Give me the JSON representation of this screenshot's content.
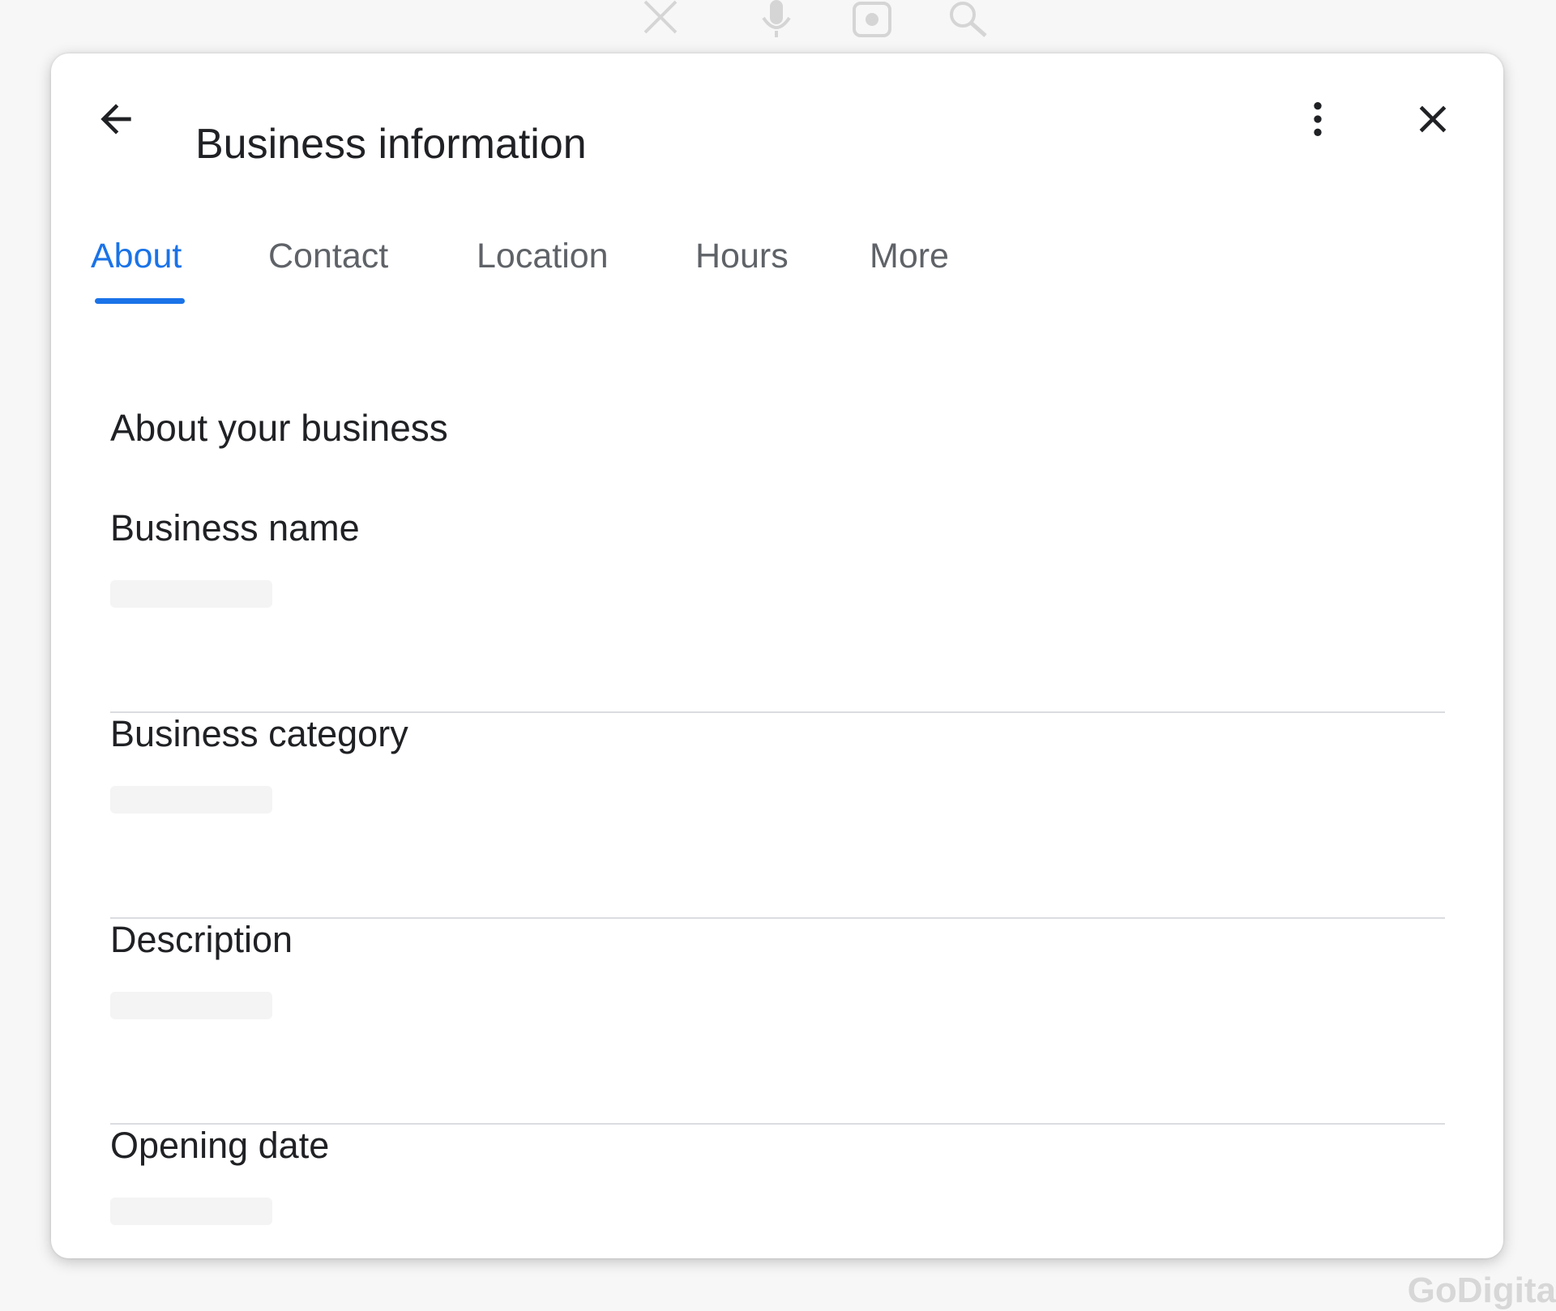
{
  "background": {
    "watermark": "GoDigita"
  },
  "dialog": {
    "title": "Business information",
    "back_icon": "arrow-back-icon",
    "more_icon": "more-vert-icon",
    "close_icon": "close-icon"
  },
  "tabs": [
    {
      "label": "About",
      "active": true
    },
    {
      "label": "Contact",
      "active": false
    },
    {
      "label": "Location",
      "active": false
    },
    {
      "label": "Hours",
      "active": false
    },
    {
      "label": "More",
      "active": false
    }
  ],
  "section": {
    "title": "About your business",
    "fields": [
      {
        "label": "Business name"
      },
      {
        "label": "Business category"
      },
      {
        "label": "Description"
      },
      {
        "label": "Opening date"
      }
    ]
  },
  "colors": {
    "accent": "#1a73e8",
    "text_primary": "#202124",
    "text_secondary": "#5f6368",
    "divider": "#dadce0"
  }
}
